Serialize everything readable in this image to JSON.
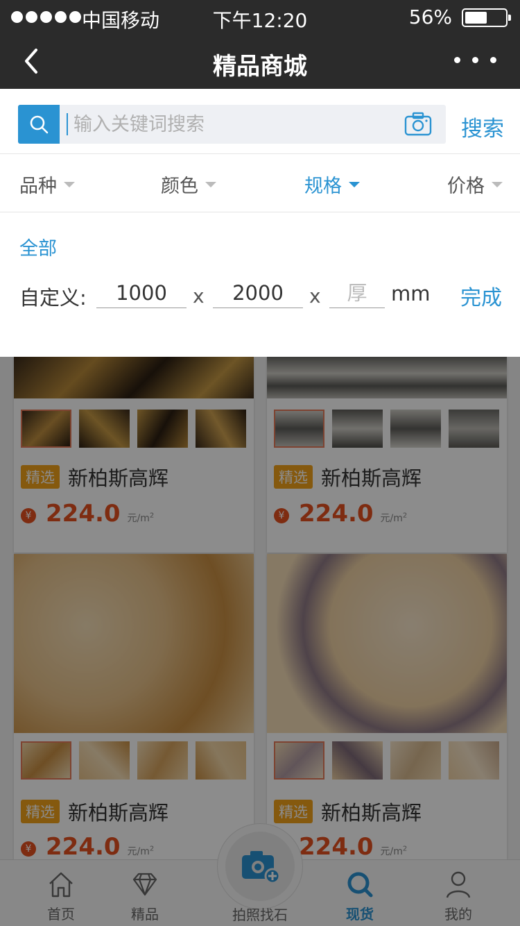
{
  "status_bar": {
    "carrier": "中国移动",
    "time": "下午12:20",
    "battery": "56%",
    "battery_level": 0.56
  },
  "nav": {
    "title": "精品商城"
  },
  "search": {
    "placeholder": "输入关键词搜索",
    "button": "搜索"
  },
  "filters": [
    {
      "label": "品种",
      "active": false
    },
    {
      "label": "颜色",
      "active": false
    },
    {
      "label": "规格",
      "active": true
    },
    {
      "label": "价格",
      "active": false
    }
  ],
  "spec": {
    "all_label": "全部",
    "custom_label": "自定义:",
    "width": "1000",
    "length": "2000",
    "thickness_placeholder": "厚",
    "sep": "x",
    "unit": "mm",
    "done": "完成"
  },
  "products": [
    {
      "tag": "精选",
      "name": "新柏斯高辉",
      "price": "224.0",
      "unit": "元/m",
      "unit_sup": "2",
      "currency": "¥"
    },
    {
      "tag": "精选",
      "name": "新柏斯高辉",
      "price": "224.0",
      "unit": "元/m",
      "unit_sup": "2",
      "currency": "¥"
    },
    {
      "tag": "精选",
      "name": "新柏斯高辉",
      "price": "224.0",
      "unit": "元/m",
      "unit_sup": "2",
      "currency": "¥"
    },
    {
      "tag": "精选",
      "name": "新柏斯高辉",
      "price": "224.0",
      "unit": "元/m",
      "unit_sup": "2",
      "currency": "¥"
    }
  ],
  "tabs": [
    {
      "label": "首页",
      "icon": "home-icon"
    },
    {
      "label": "精品",
      "icon": "diamond-icon"
    },
    {
      "label": "拍照找石",
      "icon": "camera-add-icon"
    },
    {
      "label": "现货",
      "icon": "search-icon",
      "active": true
    },
    {
      "label": "我的",
      "icon": "user-icon"
    }
  ],
  "colors": {
    "accent": "#2a93d2",
    "price": "#e5501f",
    "tag": "#f3a21a",
    "nav_bg": "#2b2b2b"
  }
}
